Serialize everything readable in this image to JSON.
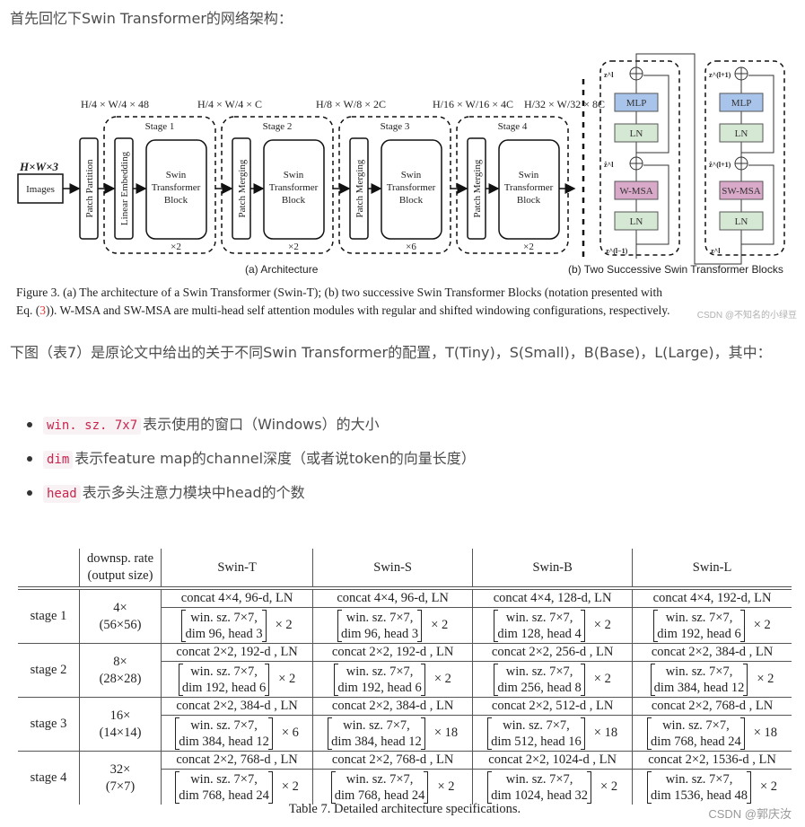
{
  "intro": "首先回忆下Swin Transformer的网络架构：",
  "figure": {
    "architecture": {
      "input_dim": "H×W×3",
      "input_label": "Images",
      "patch_partition": "Patch Partition",
      "linear_embedding": "Linear Embedding",
      "patch_merging": "Patch Merging",
      "block_lines": [
        "Swin",
        "Transformer",
        "Block"
      ],
      "stages": [
        {
          "label": "Stage 1",
          "repeat": "×2",
          "dim_top": "H/4 × W/4 × 48",
          "dim_out": "H/4 × W/4 × C"
        },
        {
          "label": "Stage 2",
          "repeat": "×2",
          "dim_out": "H/8 × W/8 × 2C"
        },
        {
          "label": "Stage 3",
          "repeat": "×6",
          "dim_out": "H/16 × W/16 × 4C"
        },
        {
          "label": "Stage 4",
          "repeat": "×2",
          "dim_out": "H/32 × W/32 × 8C"
        }
      ],
      "subcaption": "(a) Architecture"
    },
    "blocks": {
      "left": {
        "mlp": "MLP",
        "ln": "LN",
        "msa": "W-MSA",
        "z_out": "z^l",
        "z_hat": "ẑ^l",
        "z_in": "z^(l−1)"
      },
      "right": {
        "mlp": "MLP",
        "ln": "LN",
        "msa": "SW-MSA",
        "z_out": "z^(l+1)",
        "z_hat": "ẑ^(l+1)",
        "z_in": "z^l"
      },
      "subcaption": "(b) Two Successive Swin Transformer Blocks",
      "colors": {
        "mlp": "#a9c4ea",
        "ln": "#d5e8d4",
        "msa": "#d9a9c9"
      }
    },
    "caption_line1": "Figure 3. (a) The architecture of a Swin Transformer (Swin-T); (b) two successive Swin Transformer Blocks (notation presented with",
    "caption_line2_pre": "Eq. (",
    "caption_ref": "3",
    "caption_line2_post": ")). W-MSA and SW-MSA are multi-head self attention modules with regular and shifted windowing configurations, respectively.",
    "watermark": "CSDN @不知名的小绿豆"
  },
  "para2": "下图（表7）是原论文中给出的关于不同Swin Transformer的配置，T(Tiny)，S(Small)，B(Base)，L(Large)，其中：",
  "bullets": [
    {
      "code": "win. sz. 7x7",
      "text": "表示使用的窗口（Windows）的大小"
    },
    {
      "code": "dim",
      "text": "表示feature map的channel深度（或者说token的向量长度）"
    },
    {
      "code": "head",
      "text": "表示多头注意力模块中head的个数"
    }
  ],
  "table": {
    "header": {
      "col0": "",
      "col1_l1": "downsp. rate",
      "col1_l2": "(output size)",
      "models": [
        "Swin-T",
        "Swin-S",
        "Swin-B",
        "Swin-L"
      ]
    },
    "rows": [
      {
        "stage": "stage 1",
        "rate": "4×",
        "size": "(56×56)",
        "cells": [
          {
            "concat": "concat 4×4, 96-d, LN",
            "win": "win. sz. 7×7,",
            "dimhead": "dim 96, head 3",
            "rep": "× 2"
          },
          {
            "concat": "concat 4×4, 96-d, LN",
            "win": "win. sz. 7×7,",
            "dimhead": "dim 96, head 3",
            "rep": "× 2"
          },
          {
            "concat": "concat 4×4, 128-d, LN",
            "win": "win. sz. 7×7,",
            "dimhead": "dim 128, head 4",
            "rep": "× 2"
          },
          {
            "concat": "concat 4×4, 192-d, LN",
            "win": "win. sz. 7×7,",
            "dimhead": "dim 192, head 6",
            "rep": "× 2"
          }
        ]
      },
      {
        "stage": "stage 2",
        "rate": "8×",
        "size": "(28×28)",
        "cells": [
          {
            "concat": "concat 2×2, 192-d , LN",
            "win": "win. sz. 7×7,",
            "dimhead": "dim 192, head 6",
            "rep": "× 2"
          },
          {
            "concat": "concat 2×2, 192-d , LN",
            "win": "win. sz. 7×7,",
            "dimhead": "dim 192, head 6",
            "rep": "× 2"
          },
          {
            "concat": "concat 2×2, 256-d , LN",
            "win": "win. sz. 7×7,",
            "dimhead": "dim 256, head 8",
            "rep": "× 2"
          },
          {
            "concat": "concat 2×2, 384-d , LN",
            "win": "win. sz. 7×7,",
            "dimhead": "dim 384, head 12",
            "rep": "× 2"
          }
        ]
      },
      {
        "stage": "stage 3",
        "rate": "16×",
        "size": "(14×14)",
        "cells": [
          {
            "concat": "concat 2×2, 384-d , LN",
            "win": "win. sz. 7×7,",
            "dimhead": "dim 384, head 12",
            "rep": "× 6"
          },
          {
            "concat": "concat 2×2, 384-d , LN",
            "win": "win. sz. 7×7,",
            "dimhead": "dim 384, head 12",
            "rep": "× 18"
          },
          {
            "concat": "concat 2×2, 512-d , LN",
            "win": "win. sz. 7×7,",
            "dimhead": "dim 512, head 16",
            "rep": "× 18"
          },
          {
            "concat": "concat 2×2, 768-d , LN",
            "win": "win. sz. 7×7,",
            "dimhead": "dim 768, head 24",
            "rep": "× 18"
          }
        ]
      },
      {
        "stage": "stage 4",
        "rate": "32×",
        "size": "(7×7)",
        "cells": [
          {
            "concat": "concat 2×2, 768-d , LN",
            "win": "win. sz. 7×7,",
            "dimhead": "dim 768, head 24",
            "rep": "× 2"
          },
          {
            "concat": "concat 2×2, 768-d , LN",
            "win": "win. sz. 7×7,",
            "dimhead": "dim 768, head 24",
            "rep": "× 2"
          },
          {
            "concat": "concat 2×2, 1024-d , LN",
            "win": "win. sz. 7×7,",
            "dimhead": "dim 1024, head 32",
            "rep": "× 2"
          },
          {
            "concat": "concat 2×2, 1536-d , LN",
            "win": "win. sz. 7×7,",
            "dimhead": "dim 1536, head 48",
            "rep": "× 2"
          }
        ]
      }
    ],
    "caption": "Table 7. Detailed architecture specifications."
  },
  "watermark": "CSDN @郭庆汝"
}
